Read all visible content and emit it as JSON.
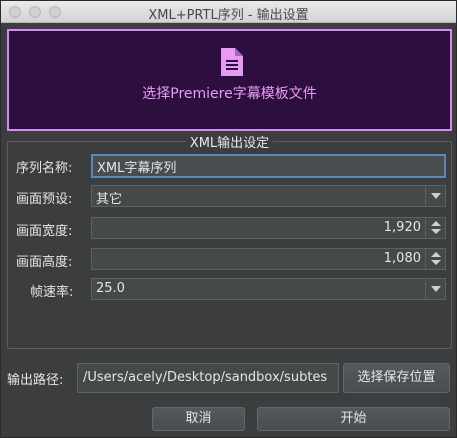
{
  "window": {
    "title": "XML+PRTL序列 - 输出设置"
  },
  "template": {
    "icon": "document-icon",
    "label": "选择Premiere字幕模板文件",
    "accent": "#d68af0"
  },
  "group": {
    "title": "XML输出设定"
  },
  "form": {
    "sequence_name_label": "序列名称:",
    "sequence_name_value": "XML字幕序列",
    "preset_label": "画面预设:",
    "preset_value": "其它",
    "width_label": "画面宽度:",
    "width_value": "1,920",
    "height_label": "画面高度:",
    "height_value": "1,080",
    "framerate_label": "帧速率:",
    "framerate_value": "25.0"
  },
  "output": {
    "path_label": "输出路径:",
    "path_value": "/Users/acely/Desktop/sandbox/subtes",
    "choose_button": "选择保存位置"
  },
  "actions": {
    "cancel": "取消",
    "start": "开始"
  }
}
